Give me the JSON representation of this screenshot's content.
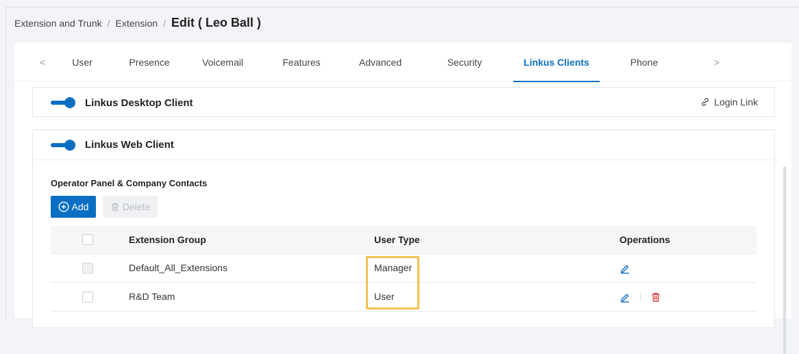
{
  "breadcrumb": {
    "item1": "Extension and Trunk",
    "sep1": "/",
    "item2": "Extension",
    "sep2": "/",
    "current": "Edit ( Leo Ball )"
  },
  "tabs": {
    "prev_icon": "chevron-left-icon",
    "next_icon": "chevron-right-icon",
    "items": [
      {
        "label": "User"
      },
      {
        "label": "Presence"
      },
      {
        "label": "Voicemail"
      },
      {
        "label": "Features"
      },
      {
        "label": "Advanced"
      },
      {
        "label": "Security"
      },
      {
        "label": "Linkus Clients",
        "active": true
      },
      {
        "label": "Phone"
      }
    ]
  },
  "desktop_client": {
    "title": "Linkus Desktop Client",
    "enabled": true,
    "login_link": "Login Link",
    "login_icon": "link-icon"
  },
  "web_client": {
    "title": "Linkus Web Client",
    "enabled": true,
    "subtitle": "Operator Panel & Company Contacts",
    "add_label": "Add",
    "delete_label": "Delete",
    "table": {
      "headers": [
        "Extension Group",
        "User Type",
        "Operations"
      ],
      "rows": [
        {
          "group": "Default_All_Extensions",
          "type": "Manager",
          "editable": true,
          "deletable": false
        },
        {
          "group": "R&D Team",
          "type": "User",
          "editable": true,
          "deletable": true
        }
      ]
    }
  },
  "colors": {
    "accent": "#0a6fc2",
    "delete_red": "#e03b3b",
    "highlight": "#f2c14e"
  }
}
